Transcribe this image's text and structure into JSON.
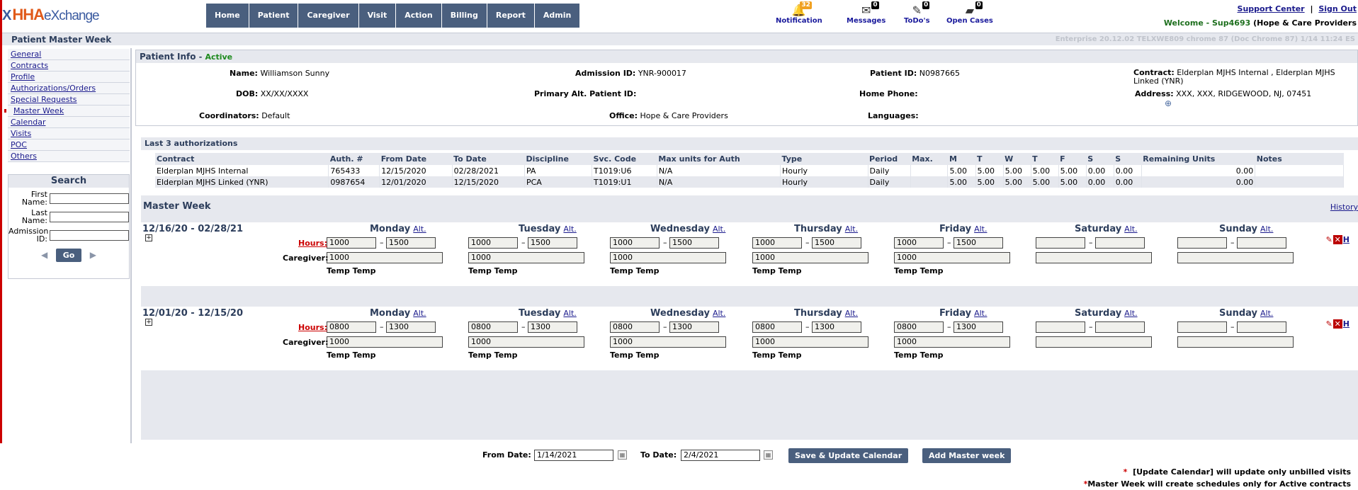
{
  "header": {
    "logo": {
      "mark": "X",
      "hha": "HHA",
      "ex": "eXchange"
    },
    "nav": [
      "Home",
      "Patient",
      "Caregiver",
      "Visit",
      "Action",
      "Billing",
      "Report",
      "Admin"
    ],
    "icons": [
      {
        "label": "Notification",
        "count": "32",
        "icon": "bell-icon"
      },
      {
        "label": "Messages",
        "count": "0",
        "icon": "envelope-icon"
      },
      {
        "label": "ToDo's",
        "count": "0",
        "icon": "todo-icon"
      },
      {
        "label": "Open Cases",
        "count": "0",
        "icon": "folder-icon"
      }
    ],
    "support_center": "Support Center",
    "separator": "|",
    "sign_out": "Sign Out",
    "welcome": "Welcome - Sup4693",
    "agency": "(Hope & Care Providers"
  },
  "titlebar": {
    "title": "Patient Master Week",
    "version": "Enterprise 20.12.02 TELXWE809 chrome 87 (Doc Chrome 87) 1/14 11:24 ES"
  },
  "sidebar": {
    "items": [
      "General",
      "Contracts",
      "Profile",
      "Authorizations/Orders",
      "Special Requests",
      "Master Week",
      "Calendar",
      "Visits",
      "POC",
      "Others"
    ],
    "search": {
      "title": "Search",
      "first_name": "First Name:",
      "last_name": "Last Name:",
      "admission_id": "Admission ID:",
      "go": "Go",
      "prev": "◀",
      "next": "▶"
    }
  },
  "patient_info": {
    "title": "Patient Info",
    "sep": "-",
    "status": "Active",
    "name_label": "Name:",
    "name": "Williamson Sunny",
    "admission_label": "Admission ID:",
    "admission": "YNR-900017",
    "patient_id_label": "Patient ID:",
    "patient_id": "N0987665",
    "contract_label": "Contract:",
    "contract": "Elderplan MJHS Internal , Elderplan MJHS Linked (YNR)",
    "dob_label": "DOB:",
    "dob": "XX/XX/XXXX",
    "alt_id_label": "Primary Alt. Patient ID:",
    "alt_id": "",
    "home_phone_label": "Home Phone:",
    "home_phone": "",
    "address_label": "Address:",
    "address": "XXX, XXX, RIDGEWOOD, NJ, 07451",
    "coordinators_label": "Coordinators:",
    "coordinators": "Default",
    "office_label": "Office:",
    "office": "Hope & Care Providers",
    "languages_label": "Languages:",
    "languages": ""
  },
  "authorizations": {
    "title": "Last 3 authorizations",
    "columns": [
      "Contract",
      "Auth. #",
      "From Date",
      "To Date",
      "Discipline",
      "Svc. Code",
      "Max units for Auth",
      "Type",
      "Period",
      "Max.",
      "M",
      "T",
      "W",
      "T",
      "F",
      "S",
      "S",
      "Remaining Units",
      "Notes"
    ],
    "rows": [
      [
        "Elderplan MJHS Internal",
        "765433",
        "12/15/2020",
        "02/28/2021",
        "PA",
        "T1019:U6",
        "N/A",
        "Hourly",
        "Daily",
        "",
        "5.00",
        "5.00",
        "5.00",
        "5.00",
        "5.00",
        "0.00",
        "0.00",
        "0.00",
        ""
      ],
      [
        "Elderplan MJHS Linked (YNR)",
        "0987654",
        "12/01/2020",
        "12/15/2020",
        "PCA",
        "T1019:U1",
        "N/A",
        "Hourly",
        "Daily",
        "",
        "5.00",
        "5.00",
        "5.00",
        "5.00",
        "5.00",
        "0.00",
        "0.00",
        "0.00",
        ""
      ]
    ]
  },
  "master_week": {
    "title": "Master Week",
    "history": "History",
    "days": [
      "Monday",
      "Tuesday",
      "Wednesday",
      "Thursday",
      "Friday",
      "Saturday",
      "Sunday"
    ],
    "alt": "Alt.",
    "hours_label": "Hours:",
    "caregiver_label": "Caregiver:",
    "dash": "–",
    "weeks": [
      {
        "range": "12/16/20 - 02/28/21",
        "start": [
          "1000",
          "1000",
          "1000",
          "1000",
          "1000",
          "",
          ""
        ],
        "end": [
          "1500",
          "1500",
          "1500",
          "1500",
          "1500",
          "",
          ""
        ],
        "caregiver": [
          "1000",
          "1000",
          "1000",
          "1000",
          "1000",
          "",
          ""
        ],
        "caregiver_name": [
          "Temp Temp",
          "Temp Temp",
          "Temp Temp",
          "Temp Temp",
          "Temp Temp",
          "",
          ""
        ]
      },
      {
        "range": "12/01/20 - 12/15/20",
        "start": [
          "0800",
          "0800",
          "0800",
          "0800",
          "0800",
          "",
          ""
        ],
        "end": [
          "1300",
          "1300",
          "1300",
          "1300",
          "1300",
          "",
          ""
        ],
        "caregiver": [
          "1000",
          "1000",
          "1000",
          "1000",
          "1000",
          "",
          ""
        ],
        "caregiver_name": [
          "Temp Temp",
          "Temp Temp",
          "Temp Temp",
          "Temp Temp",
          "Temp Temp",
          "",
          ""
        ]
      }
    ]
  },
  "footer": {
    "from_label": "From Date:",
    "from": "1/14/2021",
    "to_label": "To Date:",
    "to": "2/4/2021",
    "save": "Save & Update Calendar",
    "add": "Add Master week",
    "note1_star": "*",
    "note1": "[Update Calendar] will update only unbilled visits",
    "note2_star": "*",
    "note2": "Master Week will create schedules only for Active contracts"
  }
}
